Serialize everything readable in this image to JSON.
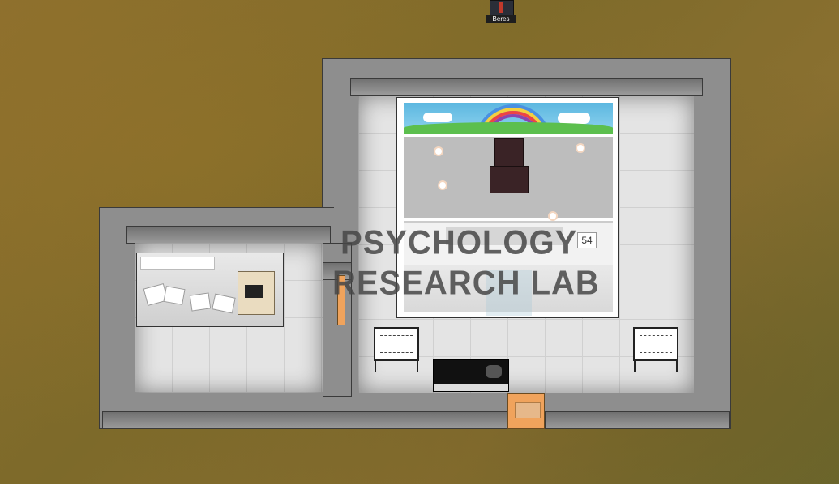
{
  "visitor": {
    "name": "Beres"
  },
  "room": {
    "label_line1": "PSYCHOLOGY",
    "label_line2": "RESEARCH LAB"
  },
  "room_counter": {
    "value": "54"
  },
  "icons": [
    "rainbow-icon",
    "flower-icon",
    "desk-icon",
    "computer-icon",
    "whiteboard-icon",
    "tv-icon"
  ],
  "colors": {
    "ground": "#8c6f2e",
    "wall": "#8e8e8e",
    "floor": "#e4e4e4",
    "door": "#f0a35c",
    "sky": "#6ec6e6",
    "grass": "#5cbf4e"
  }
}
